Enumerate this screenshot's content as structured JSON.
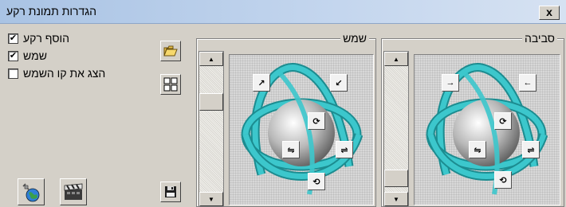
{
  "window": {
    "title": "הגדרות תמונת רקע",
    "close_label": "x"
  },
  "options": [
    {
      "label": "הוסף רקע",
      "checked": true
    },
    {
      "label": "שמש",
      "checked": true
    },
    {
      "label": "הצג את קו השמש",
      "checked": false
    }
  ],
  "checkmark": "✔",
  "groups": {
    "sun": {
      "label": "שמש"
    },
    "env": {
      "label": "סביבה"
    }
  },
  "icons": {
    "open": "folder-open-icon",
    "grid": "grid-layout-icon",
    "earth": "earth-satellite-icon",
    "film": "film-clapper-icon",
    "save": "floppy-save-icon"
  },
  "colors": {
    "title_bar": "#c4d6ee",
    "ribbon": "#2bb3b8",
    "sphere": "#b8b8b8",
    "dialog_bg": "#d4d0c8"
  }
}
